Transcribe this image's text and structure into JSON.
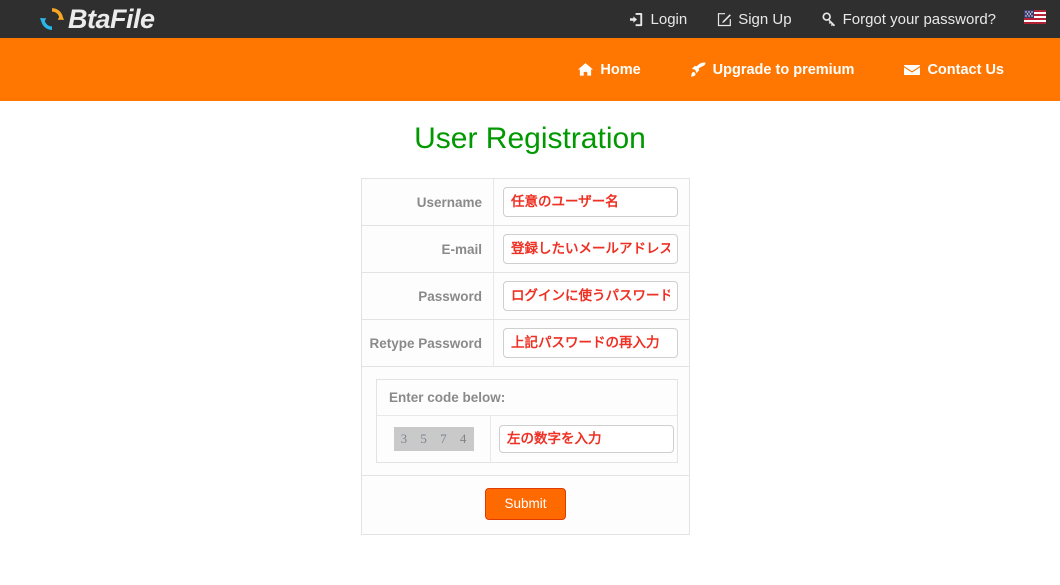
{
  "header": {
    "brand": {
      "name": "BtaFile",
      "icon": "sync-circle-icon"
    },
    "nav": [
      {
        "label": "Login",
        "icon": "sign-in-icon",
        "name": "login"
      },
      {
        "label": "Sign Up",
        "icon": "pencil-square-icon",
        "name": "signup"
      },
      {
        "label": "Forgot your password?",
        "icon": "key-icon",
        "name": "forgot-password"
      }
    ],
    "language": {
      "label": "",
      "icon": "us-flag-icon"
    },
    "background_color": "#2f2f2f"
  },
  "subnav": {
    "background_color": "#ff7700",
    "items": [
      {
        "label": "Home",
        "icon": "home-icon",
        "name": "home"
      },
      {
        "label": "Upgrade to premium",
        "icon": "rocket-icon",
        "name": "upgrade-to-premium"
      },
      {
        "label": "Contact Us",
        "icon": "envelope-icon",
        "name": "contact-us"
      }
    ]
  },
  "page": {
    "title": "User Registration",
    "title_color": "#009900"
  },
  "form": {
    "fields": [
      {
        "label": "Username",
        "value": "任意のユーザー名",
        "placeholder": "任意のユーザー名",
        "name": "username"
      },
      {
        "label": "E-mail",
        "value": "登録したいメールアドレス",
        "placeholder": "登録したいメールアドレス",
        "name": "email"
      },
      {
        "label": "Password",
        "value": "ログインに使うパスワード",
        "placeholder": "ログインに使うパスワード",
        "name": "password"
      },
      {
        "label": "Retype Password",
        "value": "上記パスワードの再入力",
        "placeholder": "上記パスワードの再入力",
        "name": "retype-password"
      }
    ],
    "captcha": {
      "heading": "Enter code below:",
      "code": "3 5 7 4",
      "value": "左の数字を入力",
      "placeholder": "左の数字を入力"
    },
    "submit_label": "Submit",
    "submit_color": "#ff6a00",
    "input_text_color": "#ee3124"
  }
}
